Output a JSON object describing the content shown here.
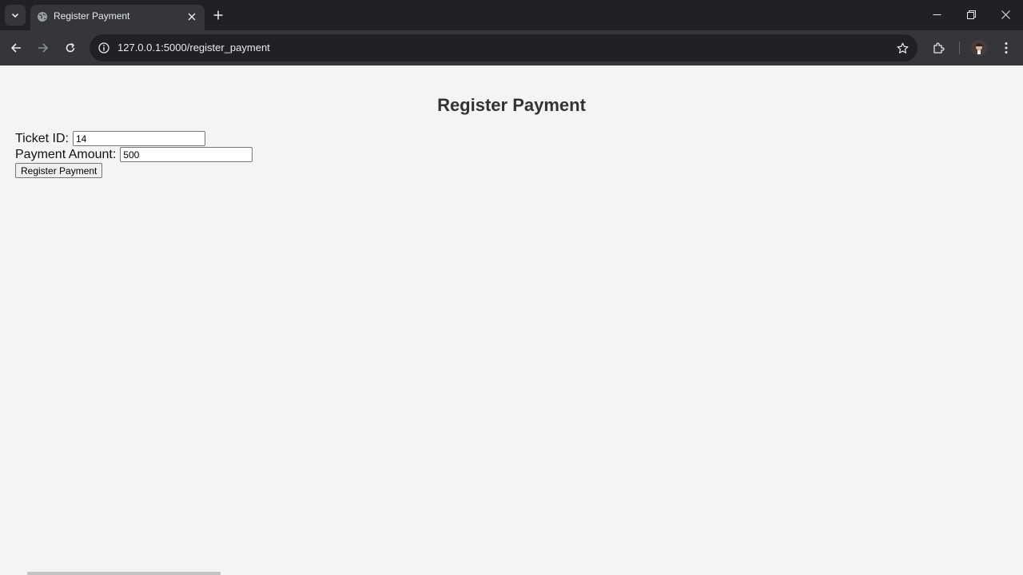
{
  "browser": {
    "tab": {
      "title": "Register Payment"
    },
    "address_bar": {
      "url": "127.0.0.1:5000/register_payment"
    }
  },
  "page": {
    "heading": "Register Payment",
    "form": {
      "ticket_id_label": "Ticket ID:",
      "ticket_id_value": "14",
      "payment_amount_label": "Payment Amount:",
      "payment_amount_value": "500",
      "submit_label": "Register Payment"
    }
  },
  "colors": {
    "chrome_dark": "#202124",
    "chrome_toolbar": "#35363a",
    "page_background": "#f4f4f4",
    "heading_text": "#333333"
  }
}
